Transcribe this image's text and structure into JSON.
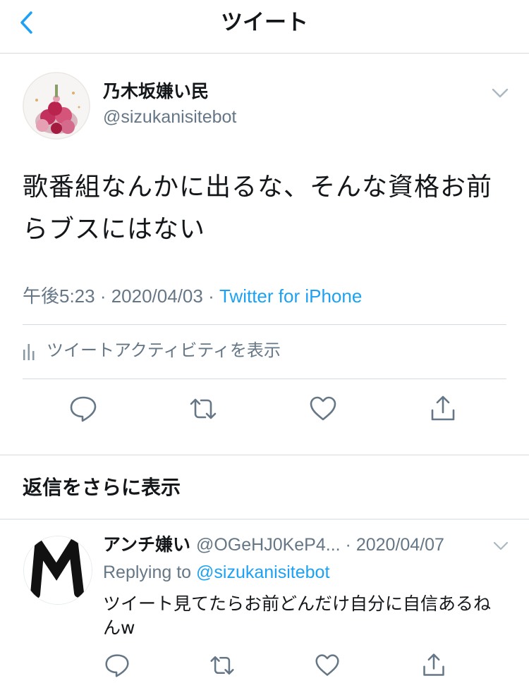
{
  "header": {
    "title": "ツイート",
    "back_icon": "chevron-left-icon"
  },
  "tweet": {
    "author_name": "乃木坂嫌い民",
    "author_handle": "@sizukanisitebot",
    "text": "歌番組なんかに出るな、そんな資格お前らブスにはない",
    "time": "午後5:23",
    "date": "2020/04/03",
    "source": "Twitter for iPhone",
    "separator": " · ",
    "activity_label": "ツイートアクティビティを表示"
  },
  "show_more_replies": "返信をさらに表示",
  "reply": {
    "author_name": "アンチ嫌い",
    "author_handle": "@OGeHJ0KeP4...",
    "date": "2020/04/07",
    "replying_to_prefix": "Replying to ",
    "replying_to_handle": "@sizukanisitebot",
    "text": "ツイート見てたらお前どんだけ自分に自信あるねんw"
  },
  "colors": {
    "accent": "#1da1f2",
    "secondary_text": "#657786",
    "divider": "#d6dbe0",
    "icon": "#657786"
  }
}
